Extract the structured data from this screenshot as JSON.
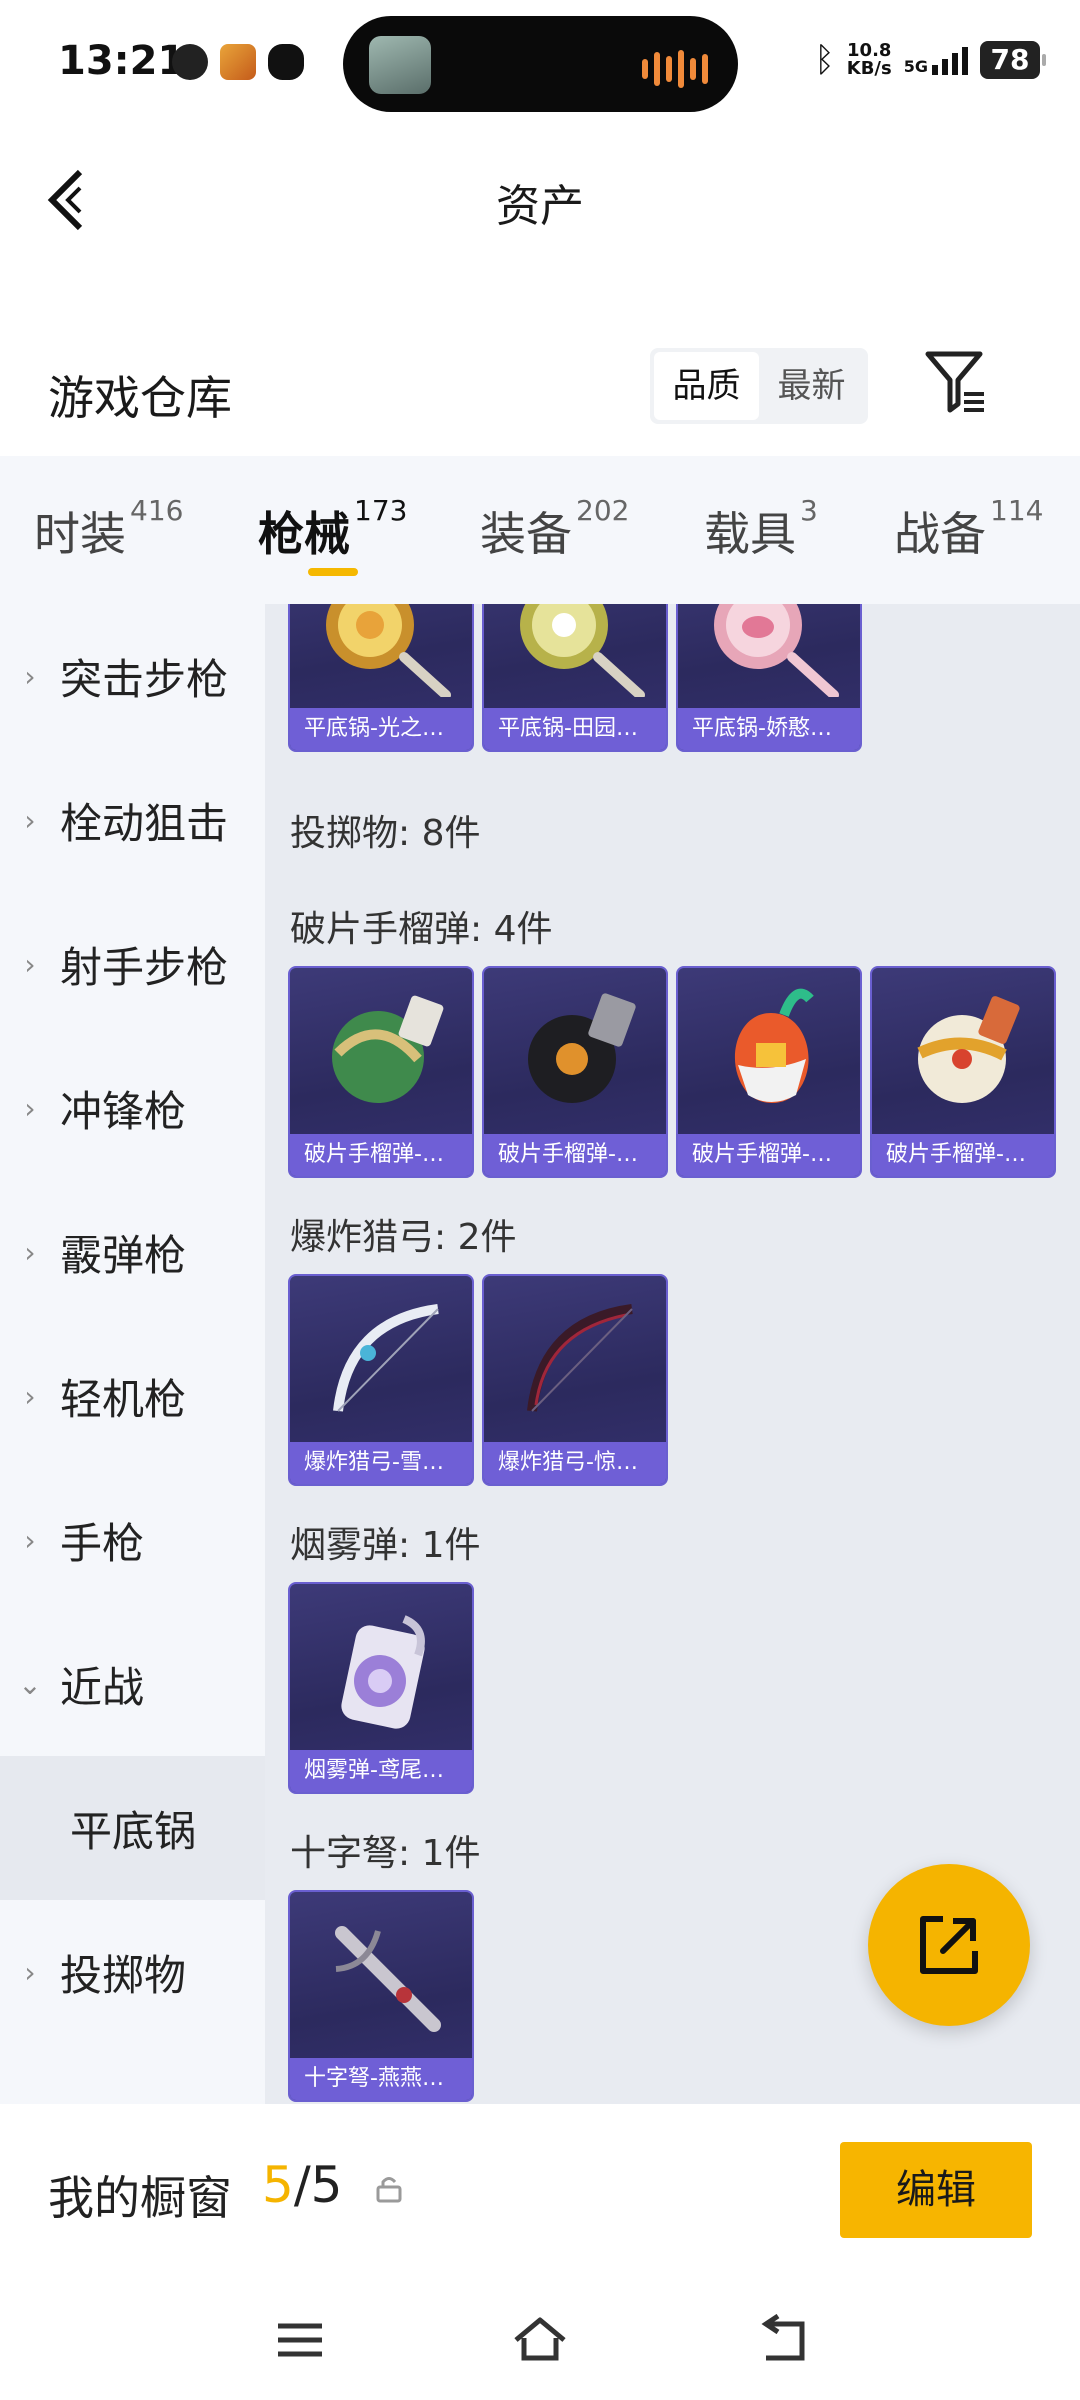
{
  "status_bar": {
    "time": "13:21",
    "net_speed_value": "10.8",
    "net_speed_unit": "KB/s",
    "network": "5G",
    "battery": "78"
  },
  "header": {
    "title": "资产"
  },
  "section": {
    "title": "游戏仓库",
    "sort_options": [
      "品质",
      "最新"
    ],
    "sort_selected": "品质"
  },
  "tabs": [
    {
      "label": "时装",
      "count": "416"
    },
    {
      "label": "枪械",
      "count": "173",
      "active": true
    },
    {
      "label": "装备",
      "count": "202"
    },
    {
      "label": "载具",
      "count": "3"
    },
    {
      "label": "战备",
      "count": "114"
    }
  ],
  "sidebar": {
    "items": [
      {
        "label": "突击步枪"
      },
      {
        "label": "栓动狙击"
      },
      {
        "label": "射手步枪"
      },
      {
        "label": "冲锋枪"
      },
      {
        "label": "霰弹枪"
      },
      {
        "label": "轻机枪"
      },
      {
        "label": "手枪"
      },
      {
        "label": "近战"
      },
      {
        "label": "平底锅"
      },
      {
        "label": "投掷物"
      }
    ]
  },
  "content": {
    "pans": [
      "平底锅-光之…",
      "平底锅-田园…",
      "平底锅-娇憨…"
    ],
    "throwables_heading": "投掷物: 8件",
    "frag_heading": "破片手榴弹: 4件",
    "frag": [
      "破片手榴弹-…",
      "破片手榴弹-…",
      "破片手榴弹-…",
      "破片手榴弹-…"
    ],
    "bow_heading": "爆炸猎弓: 2件",
    "bows": [
      "爆炸猎弓-雪…",
      "爆炸猎弓-惊…"
    ],
    "smoke_heading": "烟雾弹: 1件",
    "smoke": [
      "烟雾弹-鸢尾…"
    ],
    "crossbow_heading": "十字弩: 1件",
    "crossbow": [
      "十字弩-燕燕…"
    ]
  },
  "bottom": {
    "showcase_label": "我的橱窗",
    "showcase_current": "5",
    "showcase_sep_total": "/5",
    "edit_label": "编辑"
  },
  "icons": {
    "back": "back-arrow-icon",
    "filter": "filter-icon",
    "share": "share-external-icon",
    "lock": "lock-icon",
    "nav_menu": "menu-icon",
    "nav_home": "home-icon",
    "nav_back": "back-nav-icon"
  },
  "colors": {
    "accent": "#f5b400",
    "card_label": "#6f5fd6",
    "sidebar_bg": "#f5f7fb",
    "content_bg": "#e8ebf1"
  }
}
